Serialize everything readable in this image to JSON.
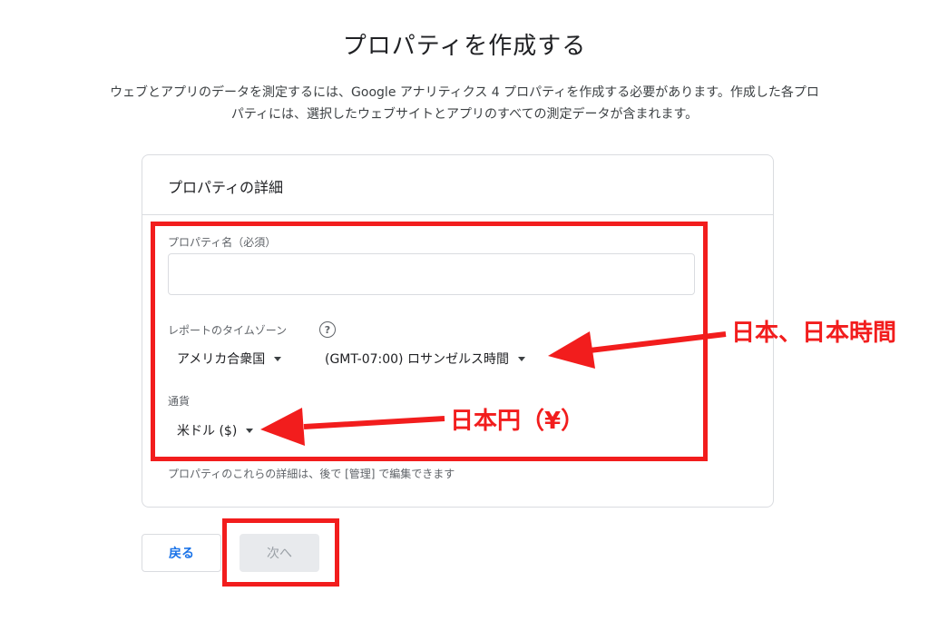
{
  "page": {
    "title": "プロパティを作成する",
    "description_line1": "ウェブとアプリのデータを測定するには、Google アナリティクス 4 プロパティを作成する必要があります。作成した各プロ",
    "description_line2": "パティには、選択したウェブサイトとアプリのすべての測定データが含まれます。"
  },
  "card": {
    "header": "プロパティの詳細",
    "property_name": {
      "label": "プロパティ名（必須）",
      "value": "",
      "placeholder": ""
    },
    "timezone": {
      "label": "レポートのタイムゾーン",
      "help_icon": "help-circle-icon",
      "country": "アメリカ合衆国",
      "zone": "(GMT-07:00) ロサンゼルス時間"
    },
    "currency": {
      "label": "通貨",
      "value": "米ドル ($)"
    },
    "helper": "プロパティのこれらの詳細は、後で [管理] で編集できます"
  },
  "buttons": {
    "back": "戻る",
    "next": "次へ"
  },
  "annotations": {
    "timezone_note": "日本、日本時間",
    "currency_note": "日本円（¥）",
    "color": "#f21d1d"
  }
}
